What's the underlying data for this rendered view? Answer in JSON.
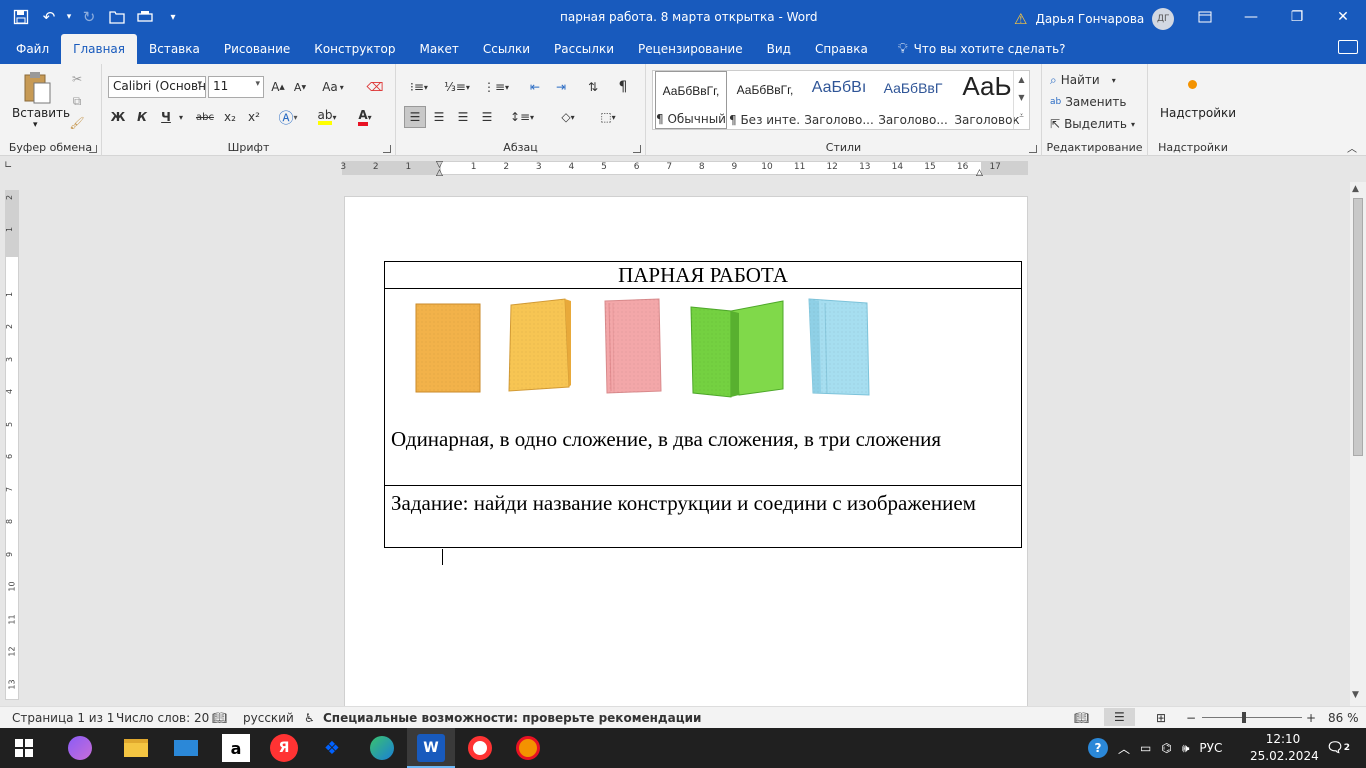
{
  "window": {
    "title": "парная работа. 8 марта открытка  -  Word",
    "user": "Дарья Гончарова",
    "avatar_initials": "ДГ"
  },
  "ribbon_tabs": [
    "Файл",
    "Главная",
    "Вставка",
    "Рисование",
    "Конструктор",
    "Макет",
    "Ссылки",
    "Рассылки",
    "Рецензирование",
    "Вид",
    "Справка"
  ],
  "tell_me": "Что вы хотите сделать?",
  "clipboard": {
    "paste": "Вставить",
    "label": "Буфер обмена"
  },
  "font": {
    "name": "Calibri (Основн",
    "size": "11",
    "label": "Шрифт",
    "bold": "Ж",
    "italic": "К",
    "underline": "Ч",
    "strike": "abc",
    "sub": "x₂",
    "sup": "x²",
    "case": "Aa"
  },
  "paragraph": {
    "label": "Абзац",
    "pilcrow": "¶"
  },
  "styles": {
    "label": "Стили",
    "items": [
      {
        "preview": "АаБбВвГг,",
        "name": "¶ Обычный"
      },
      {
        "preview": "АаБбВвГг,",
        "name": "¶ Без инте..."
      },
      {
        "preview": "АаБбВı",
        "name": "Заголово..."
      },
      {
        "preview": "АаБбВвГ",
        "name": "Заголово..."
      },
      {
        "preview": "АаЬ",
        "name": "Заголовок"
      }
    ]
  },
  "editing": {
    "find": "Найти",
    "replace": "Заменить",
    "select": "Выделить",
    "label": "Редактирование"
  },
  "addins": {
    "button": "Надстройки",
    "label": "Надстройки"
  },
  "hruler_numbers": [
    "3",
    "2",
    "1",
    "1",
    "2",
    "3",
    "4",
    "5",
    "6",
    "7",
    "8",
    "9",
    "10",
    "11",
    "12",
    "13",
    "14",
    "15",
    "16",
    "17"
  ],
  "vruler_numbers": [
    "2",
    "1",
    "1",
    "2",
    "3",
    "4",
    "5",
    "6",
    "7",
    "8",
    "9",
    "10",
    "11",
    "12",
    "13"
  ],
  "document": {
    "title": "ПАРНАЯ РАБОТА",
    "caption": "Одинарная, в одно сложение, в два сложения, в три сложения",
    "task": "Задание: найди название конструкции и соедини с изображением",
    "cards": [
      {
        "name": "single-card",
        "color": "#f2b24a"
      },
      {
        "name": "one-fold-card",
        "color": "#f7c553"
      },
      {
        "name": "two-fold-card",
        "color": "#f3a7a9"
      },
      {
        "name": "green-card",
        "color": "#74d141"
      },
      {
        "name": "three-fold-card",
        "color": "#a6def0"
      }
    ]
  },
  "status": {
    "page": "Страница 1 из 1",
    "words": "Число слов: 20",
    "lang": "русский",
    "accessibility": "Специальные возможности: проверьте рекомендации",
    "zoom": "86 %"
  },
  "taskbar": {
    "lang": "РУС",
    "time": "12:10",
    "date": "25.02.2024",
    "notifications": "2"
  },
  "colors": {
    "brand": "#185abd",
    "highlight": "#ffff00",
    "font_color": "#e81123"
  }
}
